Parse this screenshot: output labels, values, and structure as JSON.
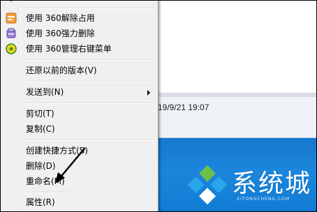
{
  "context_menu": {
    "items": [
      {
        "label": "使用 360解除占用",
        "icon": "360-unlock-icon"
      },
      {
        "label": "使用 360强力删除",
        "icon": "360-shred-icon"
      },
      {
        "label": "使用 360管理右键菜单",
        "icon": "360-manager-icon"
      },
      {
        "label": "还原以前的版本(V)"
      },
      {
        "label": "发送到(N)",
        "submenu": true
      },
      {
        "label": "剪切(T)"
      },
      {
        "label": "复制(C)"
      },
      {
        "label": "创建快捷方式(S)"
      },
      {
        "label": "删除(D)"
      },
      {
        "label": "重命名(M)"
      },
      {
        "label": "属性(R)"
      }
    ]
  },
  "background": {
    "date_modified": "19/9/21 19:07"
  },
  "watermark": {
    "text": "系统城",
    "url": "XITONGCHENG.COM"
  },
  "colors": {
    "menu_bg": "#f0f0f0",
    "desktop_blue": "#1a82d8",
    "logo_green": "#6cc04a",
    "logo_blue": "#2aa6e8"
  }
}
